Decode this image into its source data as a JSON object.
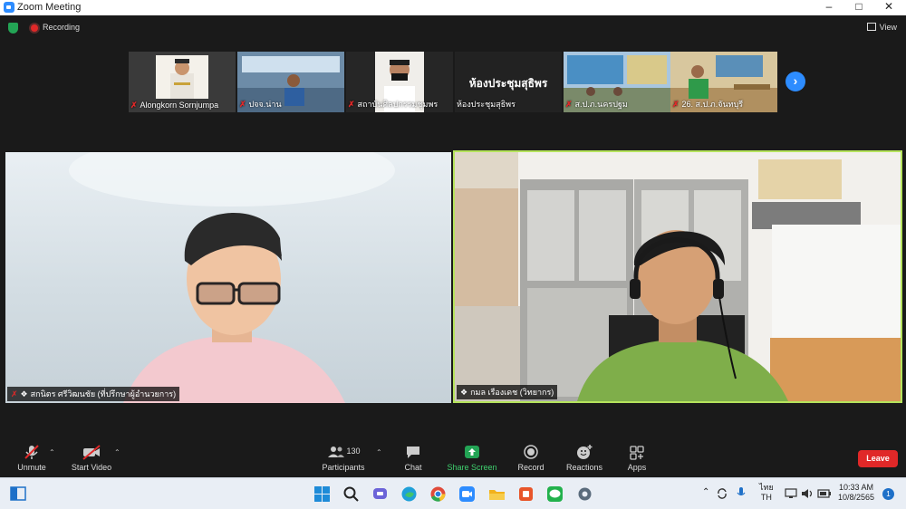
{
  "window": {
    "title": "Zoom Meeting"
  },
  "topbar": {
    "recording_label": "Recording",
    "view_label": "View"
  },
  "gallery": {
    "thumbnails": [
      {
        "name": "Alongkorn Sornjumpa",
        "muted": true,
        "content": ""
      },
      {
        "name": "ปจจ.น่าน",
        "muted": true,
        "content": ""
      },
      {
        "name": "สถาบันศิลปกรรมชุมพร",
        "muted": true,
        "content": ""
      },
      {
        "name": "ห้องประชุมสุธิพร",
        "muted": false,
        "content": "ห้องประชุมสุธิพร"
      },
      {
        "name": "ส.ป.ภ.นครปฐม",
        "muted": true,
        "content": ""
      },
      {
        "name": "26. ส.ป.ภ.จันทบุรี",
        "muted": true,
        "content": ""
      }
    ]
  },
  "main_tiles": {
    "left": {
      "name": "สกนิตร ศรีวิฒนชัย (ที่ปรึกษาผู้อำนวยการ)",
      "muted": true,
      "pinned": true
    },
    "right": {
      "name": "กมล เรืองเดช (วิทยากร)",
      "muted": false,
      "pinned": true,
      "active_speaker": true
    }
  },
  "controls": {
    "unmute_label": "Unmute",
    "start_video_label": "Start Video",
    "participants_label": "Participants",
    "participants_count": "130",
    "chat_label": "Chat",
    "share_screen_label": "Share Screen",
    "record_label": "Record",
    "reactions_label": "Reactions",
    "apps_label": "Apps",
    "leave_label": "Leave"
  },
  "taskbar": {
    "lang_top": "ไทย",
    "lang_bottom": "TH",
    "time": "10:33 AM",
    "date": "10/8/2565",
    "notification_count": "1"
  },
  "colors": {
    "accent": "#2d8cff",
    "leave": "#e02828",
    "share": "#23a455",
    "active_speaker_border": "#b5e35c",
    "background": "#1a1a1a"
  }
}
